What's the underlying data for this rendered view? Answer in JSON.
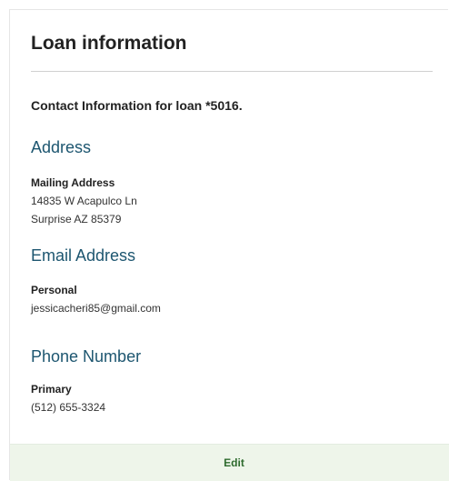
{
  "card": {
    "title": "Loan information",
    "intro": "Contact Information for loan *5016."
  },
  "address": {
    "heading": "Address",
    "label": "Mailing Address",
    "line1": "14835 W Acapulco Ln",
    "line2": "Surprise AZ 85379"
  },
  "email": {
    "heading": "Email Address",
    "label": "Personal",
    "value": "jessicacheri85@gmail.com"
  },
  "phone": {
    "heading": "Phone Number",
    "label": "Primary",
    "value": "(512) 655-3324"
  },
  "footer": {
    "edit_label": "Edit"
  },
  "colors": {
    "heading": "#1d5670",
    "footer_bg": "#eef5ea",
    "edit_text": "#2e6b2e"
  }
}
